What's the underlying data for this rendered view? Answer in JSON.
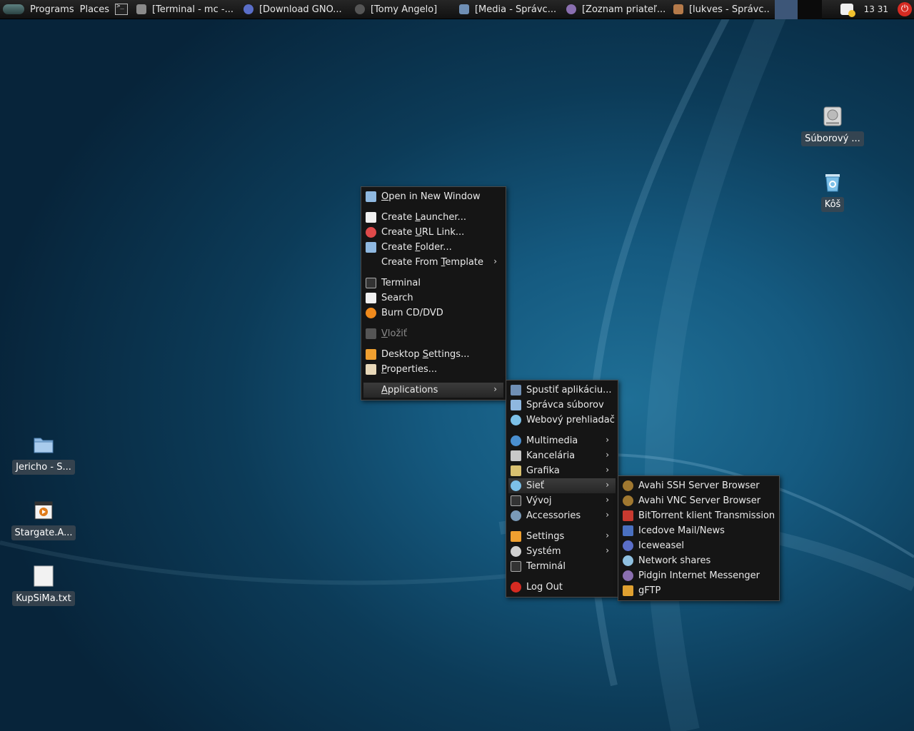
{
  "taskbar": {
    "programs": "Programs",
    "places": "Places",
    "tasks": [
      {
        "label": "[Terminal - mc -...",
        "icon": "terminal-icon",
        "color": "#8a8a8a"
      },
      {
        "label": "[Download GNO...",
        "icon": "iceweasel-icon",
        "color": "#5a6ec8"
      },
      {
        "label": "[Tomy Angelo]",
        "icon": "close-circle-icon",
        "color": "#555555"
      },
      {
        "label": "[Media - Správc...",
        "icon": "folder-icon",
        "color": "#6f8fb5"
      },
      {
        "label": "[Zoznam priateľ...",
        "icon": "pidgin-icon",
        "color": "#8a6fb0"
      },
      {
        "label": "[lukves - Správc...",
        "icon": "home-folder-icon",
        "color": "#b57a4a"
      }
    ],
    "clock": "13 31"
  },
  "desktop_icons": [
    {
      "label": "Súborový ...",
      "icon": "harddisk-icon"
    },
    {
      "label": "Kôš",
      "icon": "trash-icon"
    },
    {
      "label": "Jericho - S...",
      "icon": "folder-icon"
    },
    {
      "label": "Stargate.A...",
      "icon": "video-file-icon"
    },
    {
      "label": "KupSiMa.txt",
      "icon": "text-file-icon"
    }
  ],
  "context_menu": {
    "open_new_window": {
      "pre": "",
      "acc": "O",
      "post": "pen in New Window"
    },
    "create_launcher": {
      "pre": "Create ",
      "acc": "L",
      "post": "auncher..."
    },
    "create_url_link": {
      "pre": "Create ",
      "acc": "U",
      "post": "RL Link..."
    },
    "create_folder": {
      "pre": "Create ",
      "acc": "F",
      "post": "older..."
    },
    "create_from_template": {
      "pre": "Create From ",
      "acc": "T",
      "post": "emplate"
    },
    "terminal": "Terminal",
    "search": "Search",
    "burn": "Burn CD/DVD",
    "paste": {
      "pre": "",
      "acc": "V",
      "post": "ložiť"
    },
    "desktop_settings": {
      "pre": "Desktop ",
      "acc": "S",
      "post": "ettings..."
    },
    "properties": {
      "pre": "",
      "acc": "P",
      "post": "roperties..."
    },
    "applications": {
      "pre": "",
      "acc": "A",
      "post": "pplications"
    }
  },
  "apps_menu": {
    "items": {
      "run": "Spustiť aplikáciu...",
      "files": "Správca súborov",
      "browser": "Webový prehliadač",
      "multimedia": "Multimedia",
      "office": "Kancelária",
      "graphics": "Grafika",
      "network": "Sieť",
      "dev": "Vývoj",
      "accessories": "Accessories",
      "settings": "Settings",
      "system": "Systém",
      "terminal": "Terminál",
      "logout": "Log Out"
    }
  },
  "network_menu": {
    "items": {
      "avahi_ssh": "Avahi SSH Server Browser",
      "avahi_vnc": "Avahi VNC Server Browser",
      "transmission": "BitTorrent klient Transmission",
      "icedove": "Icedove Mail/News",
      "iceweasel": "Iceweasel",
      "shares": "Network shares",
      "pidgin": "Pidgin Internet Messenger",
      "gftp": "gFTP"
    }
  },
  "colors": {
    "menu_bg": "#151515",
    "menu_highlight": "#333333",
    "accent_blue": "#4a8fd0",
    "power_red": "#d62b22"
  }
}
